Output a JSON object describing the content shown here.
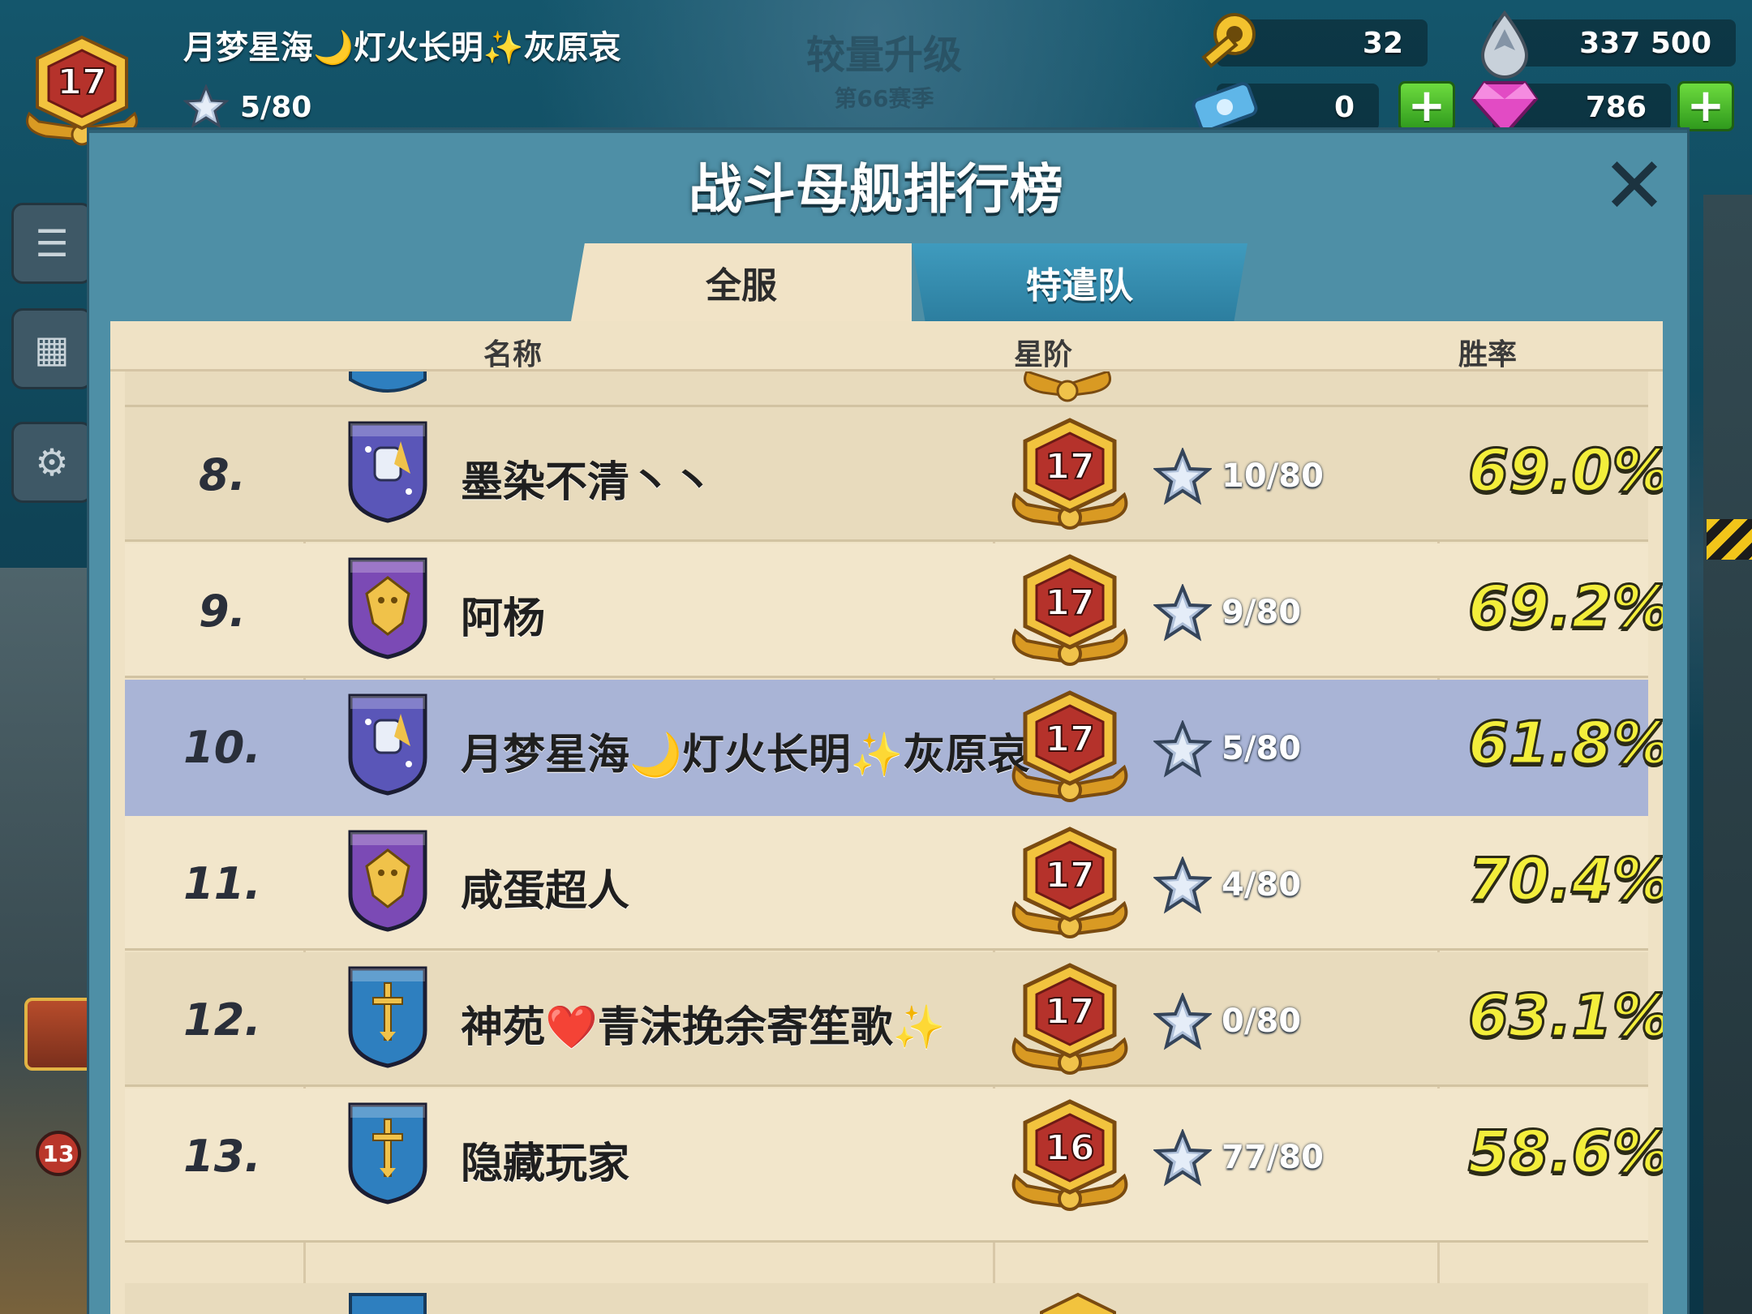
{
  "hud": {
    "level": "17",
    "player_name": "月梦星海🌙灯火长明✨灰原哀",
    "stars": "5/80",
    "keys": "32",
    "iron": "337 500",
    "tickets": "0",
    "diamonds": "786",
    "plus_symbol": "+"
  },
  "background": {
    "season_title": "较量升级",
    "season_number": "第66赛季",
    "side_badge": "13"
  },
  "panel": {
    "title": "战斗母舰排行榜",
    "close_symbol": "✕",
    "tabs": [
      {
        "label": "全服",
        "active": true
      },
      {
        "label": "特遣队",
        "active": false
      }
    ],
    "columns": {
      "name": "名称",
      "rank": "星阶",
      "win_rate": "胜率"
    }
  },
  "rows": [
    {
      "rank": "8.",
      "name": "墨染不清丶丶",
      "level": "17",
      "stars": "10/80",
      "win_rate": "69.0%",
      "emblem": "fist-shield",
      "shield_color": "#5a56b8",
      "highlight": false
    },
    {
      "rank": "9.",
      "name": "阿杨",
      "level": "17",
      "stars": "9/80",
      "win_rate": "69.2%",
      "emblem": "wolf-shield",
      "shield_color": "#7b4ab5",
      "highlight": false
    },
    {
      "rank": "10.",
      "name": "月梦星海🌙灯火长明✨灰原哀",
      "level": "17",
      "stars": "5/80",
      "win_rate": "61.8%",
      "emblem": "fist-shield",
      "shield_color": "#5a56b8",
      "highlight": true
    },
    {
      "rank": "11.",
      "name": "咸蛋超人",
      "level": "17",
      "stars": "4/80",
      "win_rate": "70.4%",
      "emblem": "wolf-shield",
      "shield_color": "#7b4ab5",
      "highlight": false
    },
    {
      "rank": "12.",
      "name": "神苑❤️青沫挽余寄笙歌✨",
      "level": "17",
      "stars": "0/80",
      "win_rate": "63.1%",
      "emblem": "sword-shield",
      "shield_color": "#2e7fbf",
      "highlight": false
    },
    {
      "rank": "13.",
      "name": "隐藏玩家",
      "level": "16",
      "stars": "77/80",
      "win_rate": "58.6%",
      "emblem": "sword-shield",
      "shield_color": "#2e7fbf",
      "highlight": false
    }
  ],
  "colors": {
    "panel": "#4e8fa6",
    "parchment": "#efe2c5",
    "highlight_row": "#a9b4d6",
    "win_rate_text": "#f3ee3b",
    "level_badge_gold": "#e9b13a",
    "level_badge_red": "#b5322b"
  }
}
